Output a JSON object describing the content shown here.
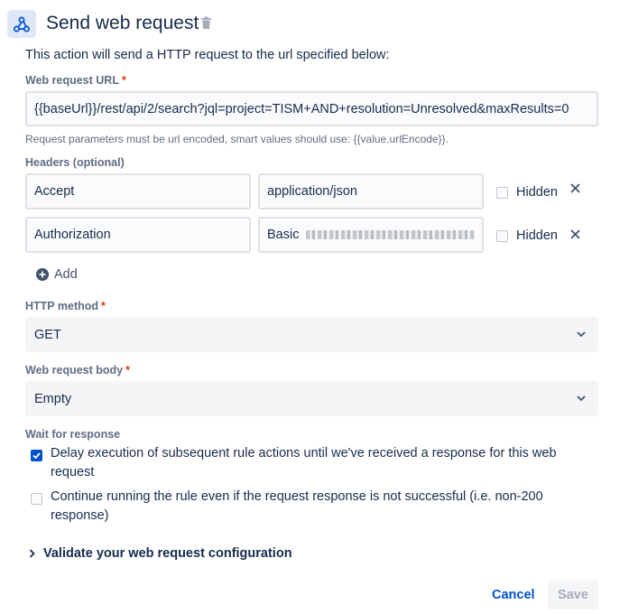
{
  "header": {
    "title": "Send web request",
    "icon": "webhook-icon",
    "delete_icon": "trash-icon"
  },
  "description": "This action will send a HTTP request to the url specified below:",
  "url_field": {
    "label": "Web request URL",
    "required_mark": "*",
    "value": "{{baseUrl}}/rest/api/2/search?jql=project=TISM+AND+resolution=Unresolved&maxResults=0",
    "help": "Request parameters must be url encoded, smart values should use: {{value.urlEncode}}."
  },
  "headers": {
    "label": "Headers (optional)",
    "rows": [
      {
        "key": "Accept",
        "value": "application/json",
        "hidden_label": "Hidden",
        "hidden_checked": false
      },
      {
        "key": "Authorization",
        "value": "Basic",
        "value_redacted": true,
        "hidden_label": "Hidden",
        "hidden_checked": false
      }
    ],
    "add_label": "Add"
  },
  "http_method": {
    "label": "HTTP method",
    "required_mark": "*",
    "selected": "GET"
  },
  "body": {
    "label": "Web request body",
    "required_mark": "*",
    "selected": "Empty"
  },
  "wait": {
    "label": "Wait for response",
    "options": [
      {
        "text_line1": "Delay execution of subsequent rule actions until we've received a response for this web",
        "text_line2": "request",
        "checked": true
      },
      {
        "text_line1": "Continue running the rule even if the request response is not successful (i.e. non-200",
        "text_line2": "response)",
        "checked": false
      }
    ]
  },
  "validate": {
    "label": "Validate your web request configuration"
  },
  "footer": {
    "cancel_label": "Cancel",
    "save_label": "Save"
  },
  "colors": {
    "primary": "#0052cc",
    "text": "#172b4d",
    "subtle": "#5e6c84",
    "required": "#de350b",
    "field_bg": "#fafbfc",
    "select_bg": "#f4f5f7"
  }
}
